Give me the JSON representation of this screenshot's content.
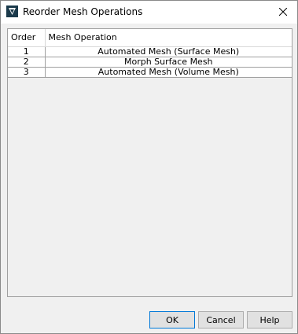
{
  "window": {
    "title": "Reorder Mesh Operations"
  },
  "table": {
    "columns": [
      "Order",
      "Mesh Operation"
    ],
    "rows": [
      {
        "order": "1",
        "operation": "Automated Mesh (Surface Mesh)"
      },
      {
        "order": "2",
        "operation": "Morph Surface Mesh"
      },
      {
        "order": "3",
        "operation": "Automated Mesh (Volume Mesh)"
      }
    ]
  },
  "buttons": {
    "ok": "OK",
    "cancel": "Cancel",
    "help": "Help"
  },
  "colors": {
    "accent": "#0078d7",
    "icon_bg": "#1b3a4b"
  },
  "icons": {
    "app": "app-logo-icon",
    "close": "close-icon"
  }
}
